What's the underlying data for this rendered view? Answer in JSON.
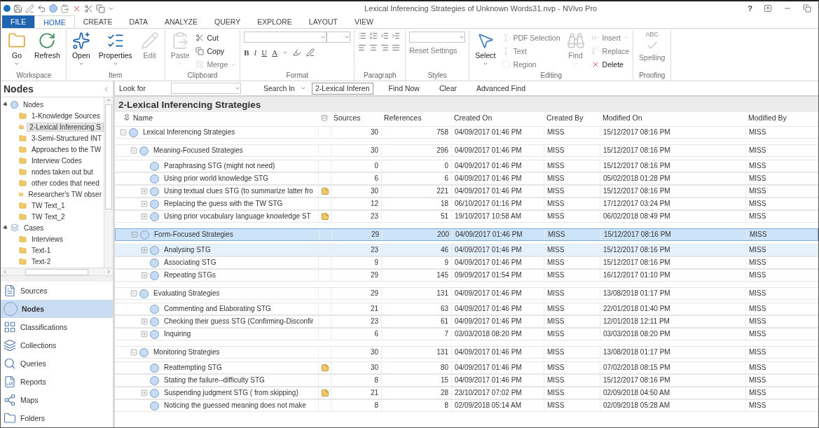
{
  "window": {
    "title": "Lexical Inferencing Strategies of Unknown Words31.nvp - NVivo Pro",
    "help": "?"
  },
  "ribbon_tabs": [
    {
      "label": "FILE",
      "kind": "file",
      "selected": false
    },
    {
      "label": "HOME",
      "kind": "tab",
      "selected": true
    },
    {
      "label": "CREATE",
      "kind": "tab",
      "selected": false
    },
    {
      "label": "DATA",
      "kind": "tab",
      "selected": false
    },
    {
      "label": "ANALYZE",
      "kind": "tab",
      "selected": false
    },
    {
      "label": "QUERY",
      "kind": "tab",
      "selected": false
    },
    {
      "label": "EXPLORE",
      "kind": "tab",
      "selected": false
    },
    {
      "label": "LAYOUT",
      "kind": "tab",
      "selected": false
    },
    {
      "label": "VIEW",
      "kind": "tab",
      "selected": false
    }
  ],
  "ribbon_groups": [
    {
      "name": "Workspace",
      "kind": "buttons",
      "items": [
        {
          "label": "Go",
          "kind": "large",
          "disabled": false,
          "dropdown": true
        },
        {
          "label": "Refresh",
          "kind": "large",
          "disabled": false,
          "dropdown": false
        }
      ]
    },
    {
      "name": "Item",
      "kind": "buttons",
      "items": [
        {
          "label": "Open",
          "kind": "large",
          "disabled": false,
          "dropdown": true
        },
        {
          "label": "Properties",
          "kind": "large",
          "disabled": false,
          "dropdown": true
        },
        {
          "label": "Edit",
          "kind": "large",
          "disabled": true,
          "dropdown": false
        }
      ]
    },
    {
      "name": "Clipboard",
      "kind": "buttons",
      "items": [
        {
          "label": "Paste",
          "kind": "large",
          "disabled": true,
          "dropdown": true
        },
        {
          "label": "Cut",
          "kind": "small",
          "disabled": false,
          "dropdown": false
        },
        {
          "label": "Copy",
          "kind": "small",
          "disabled": false,
          "dropdown": false
        },
        {
          "label": "Merge",
          "kind": "small",
          "disabled": true,
          "dropdown": true
        }
      ]
    },
    {
      "name": "Format",
      "kind": "format",
      "format_buttons": [
        "B",
        "I",
        "U",
        "A"
      ]
    },
    {
      "name": "Paragraph",
      "kind": "paragraph"
    },
    {
      "name": "Styles",
      "kind": "styles",
      "items": [
        {
          "label": "Reset Settings",
          "kind": "small",
          "disabled": true,
          "dropdown": false
        }
      ]
    },
    {
      "name": "Editing",
      "kind": "buttons",
      "items": [
        {
          "label": "Select",
          "kind": "large",
          "disabled": false,
          "dropdown": true
        },
        {
          "label": "PDF Selection",
          "kind": "small",
          "disabled": true,
          "dropdown": false
        },
        {
          "label": "Text",
          "kind": "small",
          "disabled": true,
          "dropdown": false
        },
        {
          "label": "Region",
          "kind": "small",
          "disabled": true,
          "dropdown": false
        },
        {
          "label": "Find",
          "kind": "large",
          "disabled": true,
          "dropdown": true
        },
        {
          "label": "Insert",
          "kind": "small",
          "disabled": true,
          "dropdown": true
        },
        {
          "label": "Replace",
          "kind": "small",
          "disabled": true,
          "dropdown": false
        },
        {
          "label": "Delete",
          "kind": "small",
          "disabled": false,
          "dropdown": false
        }
      ]
    },
    {
      "name": "Proofing",
      "kind": "buttons",
      "items": [
        {
          "label": "Spelling",
          "kind": "large",
          "disabled": true,
          "dropdown": false,
          "badge": "ABC"
        }
      ]
    }
  ],
  "navigator": {
    "title": "Nodes",
    "tree": [
      {
        "label": "Nodes",
        "kind": "nodes",
        "expanded": true,
        "selected": false,
        "children": [
          {
            "label": "1-Knowledge Sources",
            "kind": "folder",
            "selected": false
          },
          {
            "label": "2-Lexical Inferencing S",
            "kind": "folder",
            "selected": true
          },
          {
            "label": "3-Semi-Structured INT",
            "kind": "folder",
            "selected": false
          },
          {
            "label": "Approaches to the TW",
            "kind": "folder",
            "selected": false
          },
          {
            "label": "Interview Codes",
            "kind": "folder",
            "selected": false
          },
          {
            "label": "nodes taken out but",
            "kind": "folder",
            "selected": false
          },
          {
            "label": "other codes that need",
            "kind": "folder",
            "selected": false
          },
          {
            "label": "Researcher's TW obser",
            "kind": "folder",
            "selected": false
          },
          {
            "label": "TW Text_1",
            "kind": "folder",
            "selected": false
          },
          {
            "label": "TW Text_2",
            "kind": "folder",
            "selected": false
          }
        ]
      },
      {
        "label": "Cases",
        "kind": "cases",
        "expanded": true,
        "selected": false,
        "children": [
          {
            "label": "Interviews",
            "kind": "folder",
            "selected": false
          },
          {
            "label": "Text-1",
            "kind": "folder",
            "selected": false
          },
          {
            "label": "Text-2",
            "kind": "folder",
            "selected": false
          }
        ]
      }
    ],
    "nav_buttons": [
      {
        "label": "Sources",
        "selected": false
      },
      {
        "label": "Nodes",
        "selected": true
      },
      {
        "label": "Classifications",
        "selected": false
      },
      {
        "label": "Collections",
        "selected": false
      },
      {
        "label": "Queries",
        "selected": false
      },
      {
        "label": "Reports",
        "selected": false
      },
      {
        "label": "Maps",
        "selected": false
      },
      {
        "label": "Folders",
        "selected": false
      }
    ]
  },
  "find_bar": {
    "look_for_label": "Look for",
    "search_in_label": "Search In",
    "search_in_value": "2-Lexical Inferen",
    "buttons": [
      "Find Now",
      "Clear",
      "Advanced Find"
    ]
  },
  "detail": {
    "title": "2-Lexical Inferencing Strategies",
    "columns": [
      "Name",
      "Sources",
      "References",
      "Created On",
      "Created By",
      "Modified On",
      "Modified By"
    ],
    "rows": [
      {
        "name": "Lexical Inferencing Strategies",
        "kind": "branch",
        "expanded": true,
        "memo": false,
        "selected": false,
        "hovered": false,
        "sources": "30",
        "references": "758",
        "created_on": "04/09/2017 01:46 PM",
        "created_by": "MISS",
        "modified_on": "15/12/2017 08:16 PM",
        "modified_by": "MISS",
        "children": [
          {
            "name": "Meaning-Focused Strategies",
            "kind": "branch",
            "expanded": true,
            "memo": false,
            "selected": false,
            "hovered": false,
            "sources": "30",
            "references": "296",
            "created_on": "04/09/2017 01:46 PM",
            "created_by": "MISS",
            "modified_on": "15/12/2017 08:16 PM",
            "modified_by": "MISS",
            "children": [
              {
                "name": "Paraphrasing STG (might not need)",
                "kind": "leaf",
                "memo": false,
                "selected": false,
                "hovered": false,
                "sources": "0",
                "references": "0",
                "created_on": "04/09/2017 01:46 PM",
                "created_by": "MISS",
                "modified_on": "15/12/2017 08:16 PM",
                "modified_by": "MISS"
              },
              {
                "name": "Using prior world knowledge STG",
                "kind": "leaf",
                "memo": false,
                "selected": false,
                "hovered": false,
                "sources": "6",
                "references": "6",
                "created_on": "04/09/2017 01:46 PM",
                "created_by": "MISS",
                "modified_on": "05/02/2018 01:28 PM",
                "modified_by": "MISS"
              },
              {
                "name": "Using textual clues STG (to summarize latter fro",
                "kind": "branch",
                "expanded": false,
                "memo": true,
                "selected": false,
                "hovered": false,
                "sources": "30",
                "references": "221",
                "created_on": "04/09/2017 01:46 PM",
                "created_by": "MISS",
                "modified_on": "15/12/2017 08:16 PM",
                "modified_by": "MISS"
              },
              {
                "name": "Replacing the guess with the TW STG",
                "kind": "branch",
                "expanded": false,
                "memo": false,
                "selected": false,
                "hovered": false,
                "sources": "12",
                "references": "18",
                "created_on": "06/10/2017 01:16 PM",
                "created_by": "MISS",
                "modified_on": "17/12/2017 03:24 PM",
                "modified_by": "MISS"
              },
              {
                "name": "Using prior vocabulary language knowledge ST",
                "kind": "branch",
                "expanded": false,
                "memo": true,
                "selected": false,
                "hovered": false,
                "sources": "23",
                "references": "51",
                "created_on": "19/10/2017 10:58 AM",
                "created_by": "MISS",
                "modified_on": "06/02/2018 08:49 PM",
                "modified_by": "MISS"
              }
            ]
          },
          {
            "name": "Form-Focused Strategies",
            "kind": "branch",
            "expanded": true,
            "memo": false,
            "selected": true,
            "hovered": false,
            "sources": "29",
            "references": "200",
            "created_on": "04/09/2017 01:46 PM",
            "created_by": "MISS",
            "modified_on": "15/12/2017 08:16 PM",
            "modified_by": "MISS",
            "children": [
              {
                "name": "Analysing STG",
                "kind": "branch",
                "expanded": false,
                "memo": false,
                "selected": false,
                "hovered": true,
                "sources": "23",
                "references": "46",
                "created_on": "04/09/2017 01:46 PM",
                "created_by": "MISS",
                "modified_on": "15/12/2017 08:16 PM",
                "modified_by": "MISS"
              },
              {
                "name": "Associating STG",
                "kind": "leaf",
                "memo": false,
                "selected": false,
                "hovered": false,
                "sources": "9",
                "references": "9",
                "created_on": "04/09/2017 01:46 PM",
                "created_by": "MISS",
                "modified_on": "15/12/2017 08:16 PM",
                "modified_by": "MISS"
              },
              {
                "name": "Repeating STGs",
                "kind": "branch",
                "expanded": false,
                "memo": false,
                "selected": false,
                "hovered": false,
                "sources": "29",
                "references": "145",
                "created_on": "09/09/2017 01:54 PM",
                "created_by": "MISS",
                "modified_on": "16/12/2017 01:10 PM",
                "modified_by": "MISS"
              }
            ]
          },
          {
            "name": "Evaluating Strategies",
            "kind": "branch",
            "expanded": true,
            "memo": false,
            "selected": false,
            "hovered": false,
            "sources": "29",
            "references": "131",
            "created_on": "04/09/2017 01:46 PM",
            "created_by": "MISS",
            "modified_on": "13/08/2018 01:17 PM",
            "modified_by": "MISS",
            "children": [
              {
                "name": "Commenting and Elaborating STG",
                "kind": "leaf",
                "memo": false,
                "selected": false,
                "hovered": false,
                "sources": "21",
                "references": "63",
                "created_on": "04/09/2017 01:46 PM",
                "created_by": "MISS",
                "modified_on": "22/01/2018 01:40 PM",
                "modified_by": "MISS"
              },
              {
                "name": "Checking their guess STG (Confirming-Disconfir",
                "kind": "branch",
                "expanded": false,
                "memo": false,
                "selected": false,
                "hovered": false,
                "sources": "23",
                "references": "61",
                "created_on": "04/09/2017 01:46 PM",
                "created_by": "MISS",
                "modified_on": "12/01/2018 12:11 PM",
                "modified_by": "MISS"
              },
              {
                "name": "Inquiring",
                "kind": "branch",
                "expanded": false,
                "memo": false,
                "selected": false,
                "hovered": false,
                "sources": "6",
                "references": "7",
                "created_on": "03/03/2018 08:20 PM",
                "created_by": "MISS",
                "modified_on": "03/03/2018 08:20 PM",
                "modified_by": "MISS"
              }
            ]
          },
          {
            "name": "Monitoring Strategies",
            "kind": "branch",
            "expanded": true,
            "memo": false,
            "selected": false,
            "hovered": false,
            "sources": "30",
            "references": "131",
            "created_on": "04/09/2017 01:46 PM",
            "created_by": "MISS",
            "modified_on": "13/08/2018 01:17 PM",
            "modified_by": "MISS",
            "children": [
              {
                "name": "Reattempting STG",
                "kind": "leaf",
                "memo": true,
                "selected": false,
                "hovered": false,
                "sources": "30",
                "references": "80",
                "created_on": "04/09/2017 01:46 PM",
                "created_by": "MISS",
                "modified_on": "07/02/2018 08:15 PM",
                "modified_by": "MISS"
              },
              {
                "name": "Stating the failure--difficulty STG",
                "kind": "leaf",
                "memo": false,
                "selected": false,
                "hovered": false,
                "sources": "8",
                "references": "15",
                "created_on": "04/09/2017 01:46 PM",
                "created_by": "MISS",
                "modified_on": "15/12/2017 08:16 PM",
                "modified_by": "MISS"
              },
              {
                "name": "Suspending judgment STG ( from skipping)",
                "kind": "branch",
                "expanded": false,
                "memo": true,
                "selected": false,
                "hovered": false,
                "sources": "21",
                "references": "28",
                "created_on": "23/10/2017 07:02 PM",
                "created_by": "MISS",
                "modified_on": "02/09/2018 04:50 AM",
                "modified_by": "MISS"
              },
              {
                "name": "Noticing the guessed meaning does not make",
                "kind": "leaf",
                "memo": false,
                "selected": false,
                "hovered": false,
                "sources": "8",
                "references": "8",
                "created_on": "02/09/2018 05:14 AM",
                "created_by": "MISS",
                "modified_on": "02/09/2018 05:28 AM",
                "modified_by": "MISS"
              }
            ]
          }
        ]
      }
    ]
  }
}
